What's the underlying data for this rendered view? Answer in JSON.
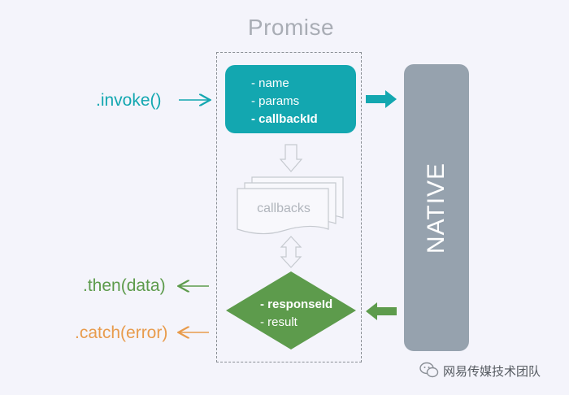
{
  "title": "Promise",
  "left_labels": {
    "invoke": ".invoke()",
    "then": ".then(data)",
    "catch": ".catch(error)"
  },
  "request_box": {
    "lines": [
      "- name",
      "- params",
      "- callbackId"
    ]
  },
  "callbacks_label": "callbacks",
  "response_diamond": {
    "lines": [
      "- responseId",
      "- result"
    ]
  },
  "native_label": "NATIVE",
  "footer": "网易传媒技术团队",
  "colors": {
    "teal": "#13a7b0",
    "green": "#5d9b4c",
    "orange": "#e89b4c",
    "native": "#96a2ae",
    "title": "#a9adb5"
  }
}
